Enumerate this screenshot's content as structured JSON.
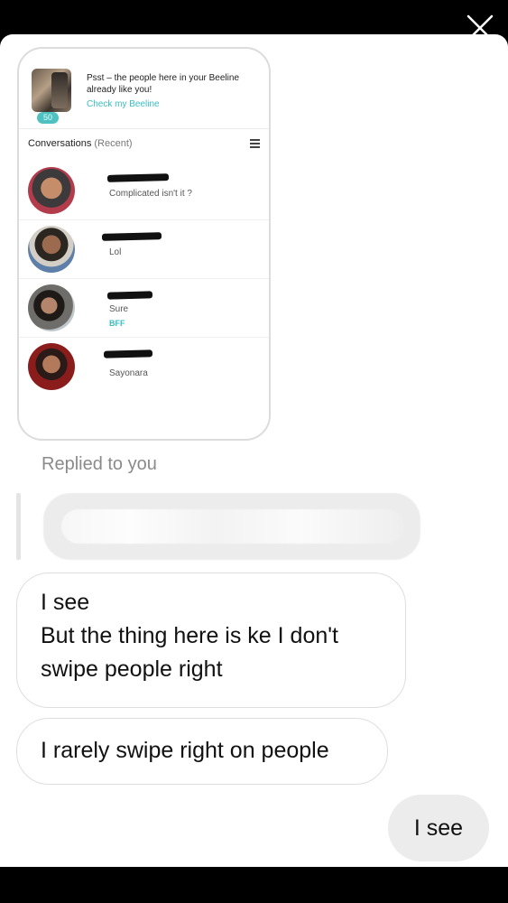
{
  "close_icon": "close-icon",
  "shared_post": {
    "beeline": {
      "count": "50",
      "text": "Psst – the people here in your Beeline already like you!",
      "link": "Check my Beeline"
    },
    "conversations": {
      "title": "Conversations",
      "subtitle": "(Recent)",
      "items": [
        {
          "message": "Complicated isn't it ?",
          "tag": ""
        },
        {
          "message": "Lol",
          "tag": ""
        },
        {
          "message": "Sure",
          "tag": "BFF"
        },
        {
          "message": "Sayonara",
          "tag": ""
        }
      ]
    }
  },
  "replied_label": "Replied to you",
  "messages": {
    "incoming_1_line1": "I see",
    "incoming_1_line2": "But the thing here is ke I don't",
    "incoming_1_line3": "swipe people right",
    "incoming_2": "I rarely swipe right on people",
    "outgoing_1": "I see"
  },
  "colors": {
    "accent": "#3cbcc0",
    "outgoing_bubble": "#ececec"
  }
}
